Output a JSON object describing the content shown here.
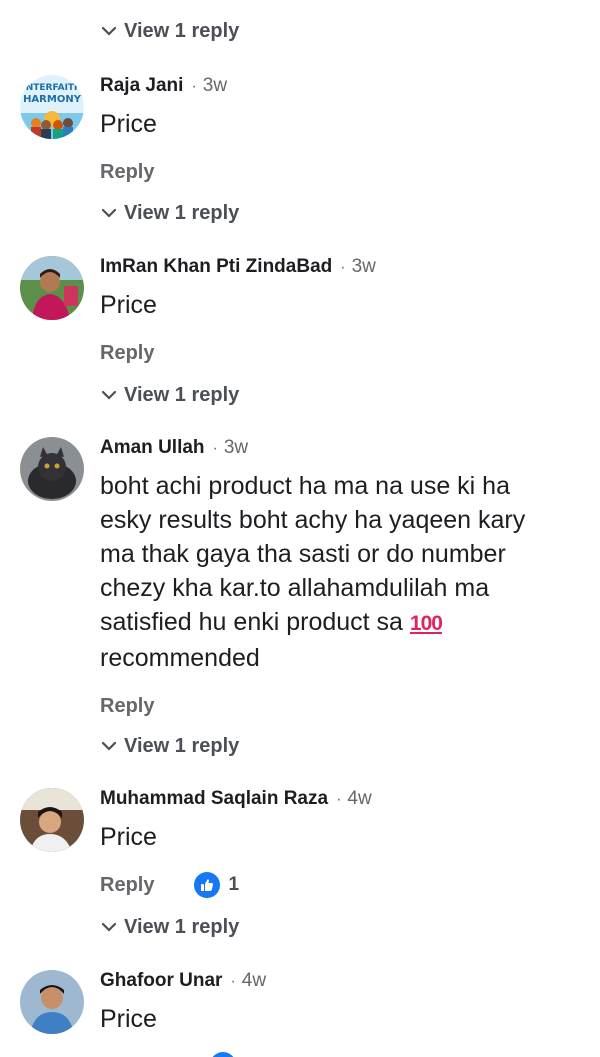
{
  "top": {
    "view_label": "View 1 reply"
  },
  "comments": [
    {
      "author": "Raja Jani",
      "time": "3w",
      "text": "Price",
      "reply_label": "Reply",
      "view_label": "View 1 reply",
      "avatar_text_1": "INTERFAITH",
      "avatar_text_2": "HARMONY"
    },
    {
      "author": "ImRan Khan Pti ZindaBad",
      "time": "3w",
      "text": "Price",
      "reply_label": "Reply",
      "view_label": "View 1 reply"
    },
    {
      "author": "Aman Ullah",
      "time": "3w",
      "text_lines": [
        "boht achi product ha ma na use ki ha",
        "esky results boht achy ha yaqeen kary",
        "ma thak gaya tha sasti or do number",
        "chezy kha kar.to allahamdulilah ma",
        "satisfied hu enki product sa",
        "recommended"
      ],
      "emoji": "100",
      "reply_label": "Reply",
      "view_label": "View 1 reply"
    },
    {
      "author": "Muhammad Saqlain Raza",
      "time": "4w",
      "text": "Price",
      "reply_label": "Reply",
      "reaction_count": "1",
      "view_label": "View 1 reply"
    },
    {
      "author": "Ghafoor Unar",
      "time": "4w",
      "text": "Price"
    }
  ],
  "colors": {
    "like_blue": "#1877f2",
    "muted": "#65676b"
  },
  "icons": [
    "chevron-down-icon",
    "like-thumb-icon"
  ]
}
